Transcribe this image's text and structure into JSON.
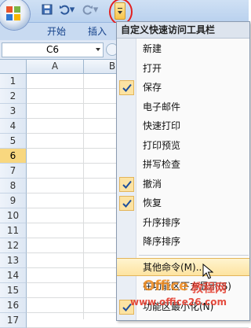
{
  "spreadsheet": {
    "tabs": [
      "开始",
      "插入"
    ],
    "name_box": "C6",
    "columns": [
      "A",
      "B"
    ],
    "rows": [
      "1",
      "2",
      "3",
      "4",
      "5",
      "6",
      "7",
      "8",
      "9",
      "10",
      "11",
      "12",
      "13",
      "14",
      "15",
      "16",
      "17"
    ],
    "selected_row": "6"
  },
  "menu": {
    "title": "自定义快速访问工具栏",
    "items": [
      {
        "label": "新建",
        "checked": false
      },
      {
        "label": "打开",
        "checked": false
      },
      {
        "label": "保存",
        "checked": true
      },
      {
        "label": "电子邮件",
        "checked": false
      },
      {
        "label": "快速打印",
        "checked": false
      },
      {
        "label": "打印预览",
        "checked": false
      },
      {
        "label": "拼写检查",
        "checked": false
      },
      {
        "label": "撤消",
        "checked": true
      },
      {
        "label": "恢复",
        "checked": true
      },
      {
        "label": "升序排序",
        "checked": false
      },
      {
        "label": "降序排序",
        "checked": false
      }
    ],
    "more_commands": "其他命令(M)...",
    "below_ribbon": "在功能区下方显示(S)",
    "minimize_ribbon": "功能区最小化(N)"
  },
  "watermark": {
    "text_a": "Office",
    "text_b": "教程网",
    "text_c": "www.office26.com"
  },
  "colors": {
    "accent_red": "#e32020",
    "highlight": "#fde3a0",
    "check_bg": "#fce3a3"
  }
}
